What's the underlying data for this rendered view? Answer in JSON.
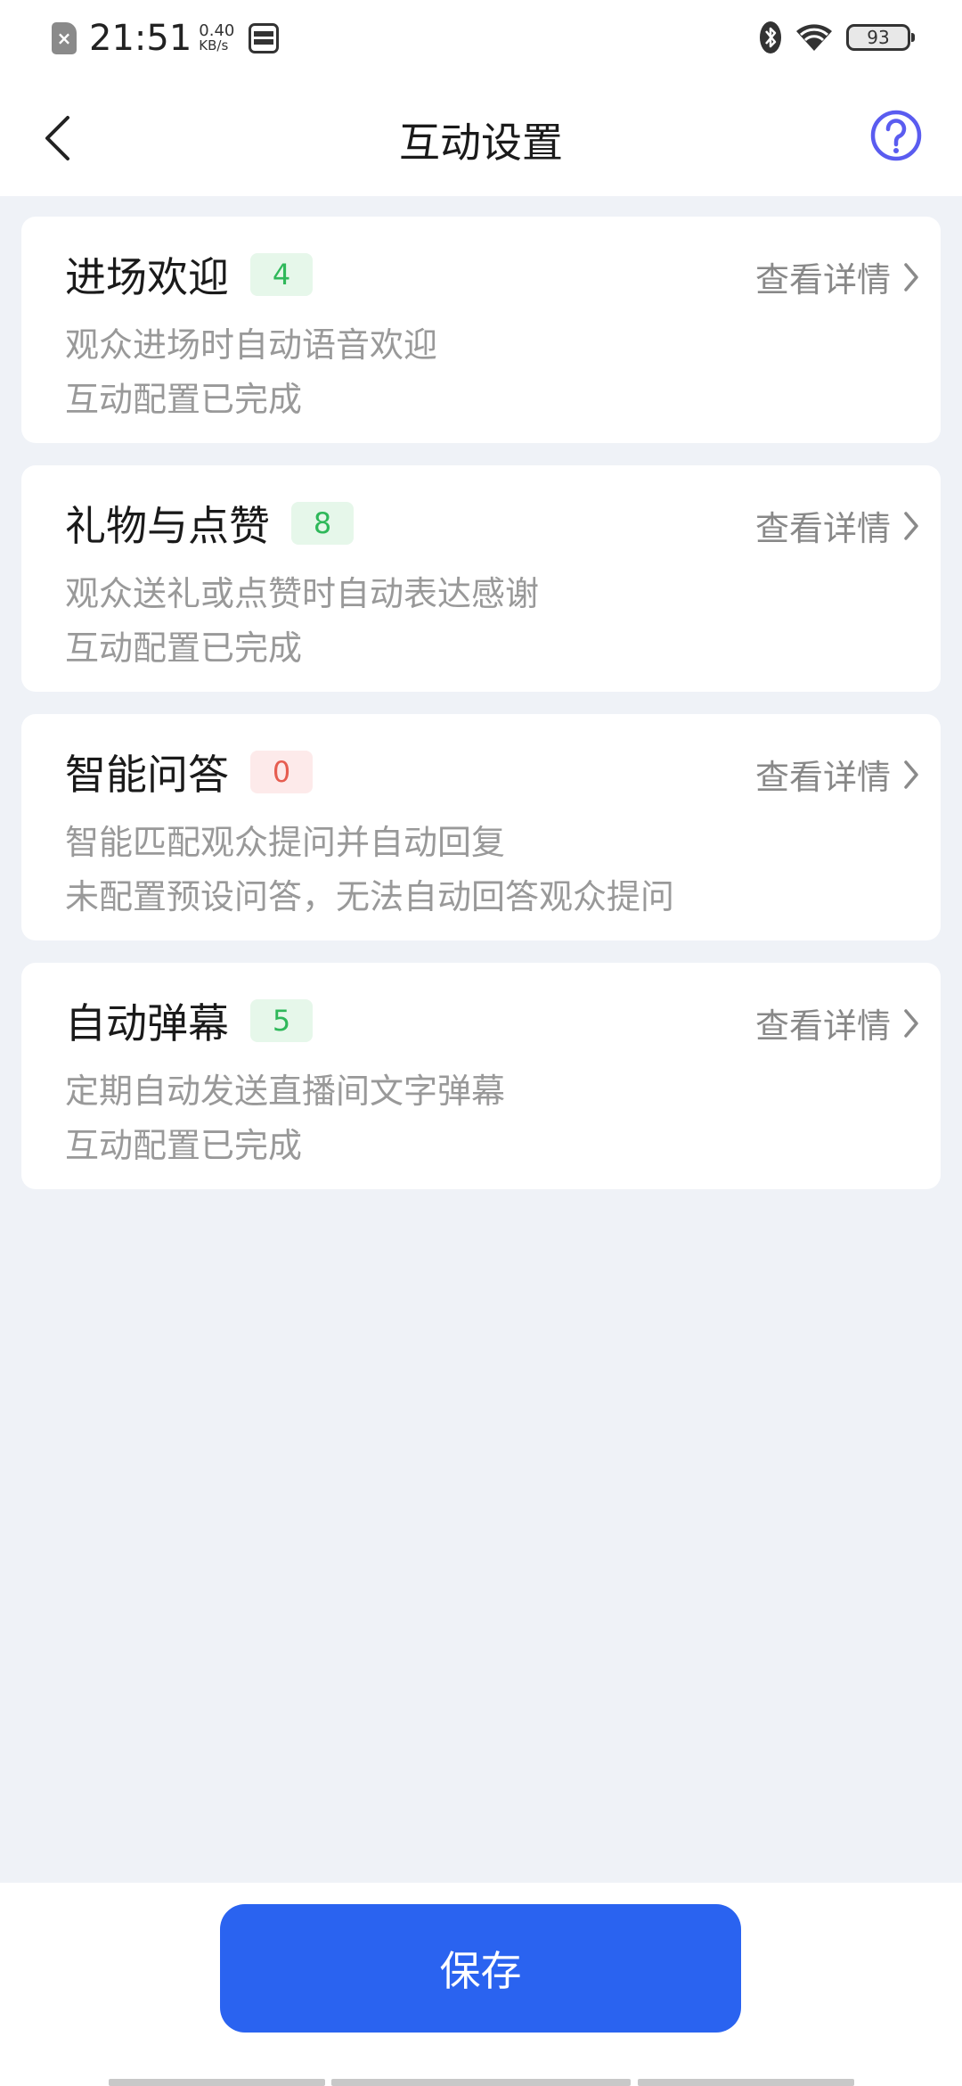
{
  "status_bar": {
    "time": "21:51",
    "net_speed_value": "0.40",
    "net_speed_unit": "KB/s",
    "battery": "93"
  },
  "header": {
    "title": "互动设置"
  },
  "cards": [
    {
      "title": "进场欢迎",
      "count": "4",
      "badge_color": "#2fb85a",
      "details_label": "查看详情",
      "description": "观众进场时自动语音欢迎",
      "status": "互动配置已完成"
    },
    {
      "title": "礼物与点赞",
      "count": "8",
      "badge_color": "#2fb85a",
      "details_label": "查看详情",
      "description": "观众送礼或点赞时自动表达感谢",
      "status": "互动配置已完成"
    },
    {
      "title": "智能问答",
      "count": "0",
      "badge_color": "#e65d50",
      "details_label": "查看详情",
      "description": "智能匹配观众提问并自动回复",
      "status": "未配置预设问答，无法自动回答观众提问"
    },
    {
      "title": "自动弹幕",
      "count": "5",
      "badge_color": "#2fb85a",
      "details_label": "查看详情",
      "description": "定期自动发送直播间文字弹幕",
      "status": "互动配置已完成"
    }
  ],
  "footer": {
    "save_label": "保存",
    "accent": "#2a63f0"
  }
}
